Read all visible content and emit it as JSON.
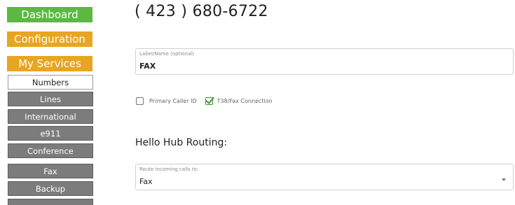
{
  "sidebar": {
    "primary": [
      {
        "label": "Dashboard",
        "color": "#5cb842"
      },
      {
        "label": "Configuration",
        "color": "#e8a521"
      },
      {
        "label": "My Services",
        "color": "#e8a521"
      }
    ],
    "sub_items": [
      {
        "label": "Numbers",
        "active": true
      },
      {
        "label": "Lines",
        "active": false
      },
      {
        "label": "International",
        "active": false
      },
      {
        "label": "e911",
        "active": false
      },
      {
        "label": "Conference",
        "active": false
      },
      {
        "label": "Fax",
        "active": false
      },
      {
        "label": "Backup",
        "active": false
      }
    ]
  },
  "main": {
    "phone_number": "( 423 ) 680-6722",
    "label_field": {
      "label": "Label/Name (optional)",
      "value": "FAX"
    },
    "options": {
      "primary_caller_id": {
        "label": "Primary Caller ID",
        "checked": false
      },
      "t38_fax": {
        "label": "T38/Fax Connection",
        "checked": true
      }
    },
    "routing": {
      "title": "Hello Hub Routing:",
      "select_label": "Route incoming calls to:",
      "select_value": "Fax"
    }
  },
  "colors": {
    "green": "#5cb842",
    "orange": "#e8a521",
    "gray_nav": "#7c7c7c"
  }
}
